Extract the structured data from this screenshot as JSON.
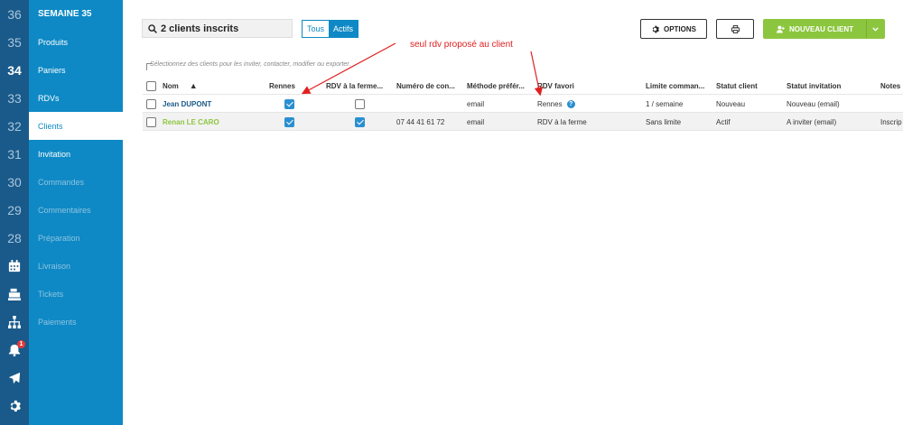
{
  "weeks": {
    "cells": [
      "36",
      "35",
      "34",
      "33",
      "32",
      "31",
      "30",
      "29",
      "28"
    ],
    "current": "34",
    "notification_count": "1"
  },
  "menu": {
    "header": "SEMAINE 35",
    "items": [
      {
        "label": "Produits",
        "state": "normal"
      },
      {
        "label": "Paniers",
        "state": "normal"
      },
      {
        "label": "RDVs",
        "state": "normal"
      },
      {
        "label": "Clients",
        "state": "active"
      },
      {
        "label": "Invitation",
        "state": "normal"
      },
      {
        "label": "Commandes",
        "state": "dim"
      },
      {
        "label": "Commentaires",
        "state": "dim"
      },
      {
        "label": "Préparation",
        "state": "dim"
      },
      {
        "label": "Livraison",
        "state": "dim"
      },
      {
        "label": "Tickets",
        "state": "dim"
      },
      {
        "label": "Paiements",
        "state": "dim"
      }
    ]
  },
  "toolbar": {
    "search_label": "2 clients inscrits",
    "filter_all": "Tous",
    "filter_active": "Actifs",
    "options_label": "OPTIONS",
    "new_client_label": "NOUVEAU CLIENT"
  },
  "hint": "Sélectionnez des clients pour les inviter, contacter, modifier ou exporter.",
  "table": {
    "columns": [
      "Nom",
      "Rennes",
      "RDV à la ferme...",
      "Numéro de con...",
      "Méthode préfér...",
      "RDV favori",
      "Limite comman...",
      "Statut client",
      "Statut invitation",
      "Notes"
    ],
    "sort_indicator": "▲",
    "rows": [
      {
        "name": "Jean DUPONT",
        "rennes": true,
        "ferme": false,
        "phone": "",
        "method": "email",
        "favori": "Rennes",
        "limit": "1 / semaine",
        "status": "Nouveau",
        "invitation": "Nouveau (email)",
        "notes": ""
      },
      {
        "name": "Renan LE CARO",
        "rennes": true,
        "ferme": true,
        "phone": "07 44 41 61 72",
        "method": "email",
        "favori": "RDV à la ferme",
        "limit": "Sans limite",
        "status": "Actif",
        "invitation": "A inviter (email)",
        "notes": "Inscrip"
      }
    ]
  },
  "annotation": {
    "text": "seul rdv proposé au client",
    "color": "#e02020"
  },
  "colors": {
    "rail": "#1a5a8a",
    "menu": "#0e89c5",
    "accent_green": "#8cc63f",
    "checkbox_on": "#2a8fd0"
  }
}
